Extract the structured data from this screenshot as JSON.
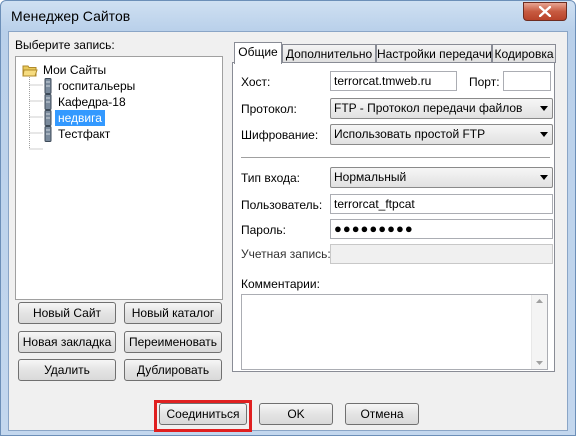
{
  "window": {
    "title": "Менеджер Сайтов"
  },
  "left": {
    "select_label": "Выберите запись:",
    "tree": [
      {
        "label": "Мои Сайты",
        "icon": "folder-open-icon"
      },
      {
        "label": "госпитальеры",
        "icon": "server-icon"
      },
      {
        "label": "Кафедра-18",
        "icon": "server-icon"
      },
      {
        "label": "недвига",
        "icon": "server-icon",
        "selected": true
      },
      {
        "label": "Тестфакт",
        "icon": "server-icon"
      }
    ],
    "buttons": {
      "new_site": "Новый Сайт",
      "new_folder": "Новый каталог",
      "new_bookmark": "Новая закладка",
      "rename": "Переименовать",
      "delete": "Удалить",
      "duplicate": "Дублировать"
    }
  },
  "tabs": [
    "Общие",
    "Дополнительно",
    "Настройки передачи",
    "Кодировка"
  ],
  "general": {
    "host_label": "Хост:",
    "host_value": "terrorcat.tmweb.ru",
    "port_label": "Порт:",
    "port_value": "",
    "protocol_label": "Протокол:",
    "protocol_value": "FTP - Протокол передачи файлов",
    "encryption_label": "Шифрование:",
    "encryption_value": "Использовать простой FTP",
    "logon_label": "Тип входа:",
    "logon_value": "Нормальный",
    "user_label": "Пользователь:",
    "user_value": "terrorcat_ftpcat",
    "password_label": "Пароль:",
    "password_value": "●●●●●●●●●",
    "account_label": "Учетная запись:",
    "account_value": "",
    "comments_label": "Комментарии:"
  },
  "footer": {
    "connect": "Соединиться",
    "ok": "OK",
    "cancel": "Отмена"
  },
  "colors": {
    "highlight": "#e02020",
    "selection": "#3399ff"
  }
}
